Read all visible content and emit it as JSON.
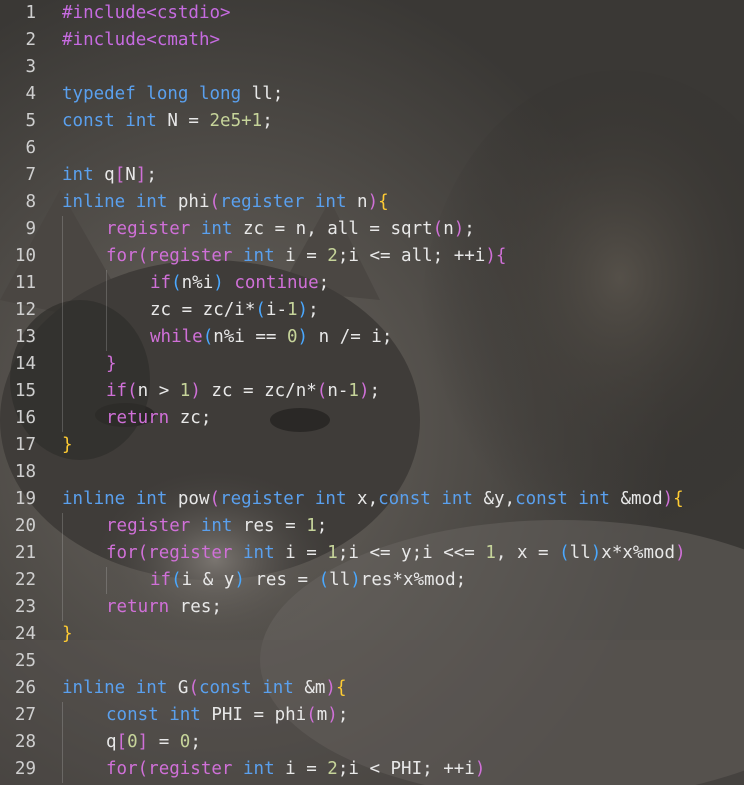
{
  "editor": {
    "lines": [
      {
        "n": "1",
        "indent": 0,
        "tokens": [
          [
            "pp",
            "#include<cstdio>"
          ]
        ]
      },
      {
        "n": "2",
        "indent": 0,
        "tokens": [
          [
            "pp",
            "#include<cmath>"
          ]
        ]
      },
      {
        "n": "3",
        "indent": 0,
        "tokens": []
      },
      {
        "n": "4",
        "indent": 0,
        "tokens": [
          [
            "kw",
            "typedef long long"
          ],
          [
            "tx",
            " ll;"
          ]
        ]
      },
      {
        "n": "5",
        "indent": 0,
        "tokens": [
          [
            "kw",
            "const int"
          ],
          [
            "tx",
            " N = "
          ],
          [
            "num",
            "2e5+1"
          ],
          [
            "tx",
            ";"
          ]
        ]
      },
      {
        "n": "6",
        "indent": 0,
        "tokens": []
      },
      {
        "n": "7",
        "indent": 0,
        "tokens": [
          [
            "kw",
            "int"
          ],
          [
            "tx",
            " q"
          ],
          [
            "br2",
            "["
          ],
          [
            "tx",
            "N"
          ],
          [
            "br2",
            "]"
          ],
          [
            "tx",
            ";"
          ]
        ]
      },
      {
        "n": "8",
        "indent": 0,
        "tokens": [
          [
            "kw",
            "inline int"
          ],
          [
            "tx",
            " phi"
          ],
          [
            "br2",
            "("
          ],
          [
            "kw",
            "register int"
          ],
          [
            "tx",
            " n"
          ],
          [
            "br2",
            ")"
          ],
          [
            "br1",
            "{"
          ]
        ]
      },
      {
        "n": "9",
        "indent": 1,
        "tokens": [
          [
            "ctl",
            "register"
          ],
          [
            "tx",
            " "
          ],
          [
            "kw",
            "int"
          ],
          [
            "tx",
            " zc = n, all = sqrt"
          ],
          [
            "br2",
            "("
          ],
          [
            "tx",
            "n"
          ],
          [
            "br2",
            ")"
          ],
          [
            "tx",
            ";"
          ]
        ]
      },
      {
        "n": "10",
        "indent": 1,
        "tokens": [
          [
            "ctl",
            "for"
          ],
          [
            "br2",
            "("
          ],
          [
            "ctl",
            "register"
          ],
          [
            "tx",
            " "
          ],
          [
            "kw",
            "int"
          ],
          [
            "tx",
            " i = "
          ],
          [
            "num",
            "2"
          ],
          [
            "tx",
            ";i <= all; ++i"
          ],
          [
            "br2",
            ")"
          ],
          [
            "br2",
            "{"
          ]
        ]
      },
      {
        "n": "11",
        "indent": 2,
        "tokens": [
          [
            "ctl",
            "if"
          ],
          [
            "br3",
            "("
          ],
          [
            "tx",
            "n%i"
          ],
          [
            "br3",
            ")"
          ],
          [
            "tx",
            " "
          ],
          [
            "ctl",
            "continue"
          ],
          [
            "tx",
            ";"
          ]
        ]
      },
      {
        "n": "12",
        "indent": 2,
        "tokens": [
          [
            "tx",
            "zc = zc/i*"
          ],
          [
            "br3",
            "("
          ],
          [
            "tx",
            "i-"
          ],
          [
            "num",
            "1"
          ],
          [
            "br3",
            ")"
          ],
          [
            "tx",
            ";"
          ]
        ]
      },
      {
        "n": "13",
        "indent": 2,
        "tokens": [
          [
            "ctl",
            "while"
          ],
          [
            "br3",
            "("
          ],
          [
            "tx",
            "n%i == "
          ],
          [
            "num",
            "0"
          ],
          [
            "br3",
            ")"
          ],
          [
            "tx",
            " n /= i;"
          ]
        ]
      },
      {
        "n": "14",
        "indent": 1,
        "tokens": [
          [
            "br2",
            "}"
          ]
        ]
      },
      {
        "n": "15",
        "indent": 1,
        "tokens": [
          [
            "ctl",
            "if"
          ],
          [
            "br2",
            "("
          ],
          [
            "tx",
            "n > "
          ],
          [
            "num",
            "1"
          ],
          [
            "br2",
            ")"
          ],
          [
            "tx",
            " zc = zc/n*"
          ],
          [
            "br2",
            "("
          ],
          [
            "tx",
            "n-"
          ],
          [
            "num",
            "1"
          ],
          [
            "br2",
            ")"
          ],
          [
            "tx",
            ";"
          ]
        ]
      },
      {
        "n": "16",
        "indent": 1,
        "tokens": [
          [
            "ctl",
            "return"
          ],
          [
            "tx",
            " zc;"
          ]
        ]
      },
      {
        "n": "17",
        "indent": 0,
        "tokens": [
          [
            "br1",
            "}"
          ]
        ]
      },
      {
        "n": "18",
        "indent": 0,
        "tokens": []
      },
      {
        "n": "19",
        "indent": 0,
        "tokens": [
          [
            "kw",
            "inline int"
          ],
          [
            "tx",
            " pow"
          ],
          [
            "br2",
            "("
          ],
          [
            "kw",
            "register int"
          ],
          [
            "tx",
            " x,"
          ],
          [
            "kw",
            "const int"
          ],
          [
            "tx",
            " &y,"
          ],
          [
            "kw",
            "const int"
          ],
          [
            "tx",
            " &mod"
          ],
          [
            "br2",
            ")"
          ],
          [
            "br1",
            "{"
          ]
        ]
      },
      {
        "n": "20",
        "indent": 1,
        "tokens": [
          [
            "ctl",
            "register"
          ],
          [
            "tx",
            " "
          ],
          [
            "kw",
            "int"
          ],
          [
            "tx",
            " res = "
          ],
          [
            "num",
            "1"
          ],
          [
            "tx",
            ";"
          ]
        ]
      },
      {
        "n": "21",
        "indent": 1,
        "tokens": [
          [
            "ctl",
            "for"
          ],
          [
            "br2",
            "("
          ],
          [
            "ctl",
            "register"
          ],
          [
            "tx",
            " "
          ],
          [
            "kw",
            "int"
          ],
          [
            "tx",
            " i = "
          ],
          [
            "num",
            "1"
          ],
          [
            "tx",
            ";i <= y;i <<= "
          ],
          [
            "num",
            "1"
          ],
          [
            "tx",
            ", x = "
          ],
          [
            "br3",
            "("
          ],
          [
            "tx",
            "ll"
          ],
          [
            "br3",
            ")"
          ],
          [
            "tx",
            "x*x%mod"
          ],
          [
            "br2",
            ")"
          ]
        ]
      },
      {
        "n": "22",
        "indent": 2,
        "tokens": [
          [
            "ctl",
            "if"
          ],
          [
            "br3",
            "("
          ],
          [
            "tx",
            "i & y"
          ],
          [
            "br3",
            ")"
          ],
          [
            "tx",
            " res = "
          ],
          [
            "br3",
            "("
          ],
          [
            "tx",
            "ll"
          ],
          [
            "br3",
            ")"
          ],
          [
            "tx",
            "res*x%mod;"
          ]
        ]
      },
      {
        "n": "23",
        "indent": 1,
        "tokens": [
          [
            "ctl",
            "return"
          ],
          [
            "tx",
            " res;"
          ]
        ]
      },
      {
        "n": "24",
        "indent": 0,
        "tokens": [
          [
            "br1",
            "}"
          ]
        ]
      },
      {
        "n": "25",
        "indent": 0,
        "tokens": []
      },
      {
        "n": "26",
        "indent": 0,
        "tokens": [
          [
            "kw",
            "inline int"
          ],
          [
            "tx",
            " G"
          ],
          [
            "br2",
            "("
          ],
          [
            "kw",
            "const int"
          ],
          [
            "tx",
            " &m"
          ],
          [
            "br2",
            ")"
          ],
          [
            "br1",
            "{"
          ]
        ]
      },
      {
        "n": "27",
        "indent": 1,
        "tokens": [
          [
            "kw",
            "const int"
          ],
          [
            "tx",
            " PHI = phi"
          ],
          [
            "br2",
            "("
          ],
          [
            "tx",
            "m"
          ],
          [
            "br2",
            ")"
          ],
          [
            "tx",
            ";"
          ]
        ]
      },
      {
        "n": "28",
        "indent": 1,
        "tokens": [
          [
            "tx",
            "q"
          ],
          [
            "br2",
            "["
          ],
          [
            "num",
            "0"
          ],
          [
            "br2",
            "]"
          ],
          [
            "tx",
            " = "
          ],
          [
            "num",
            "0"
          ],
          [
            "tx",
            ";"
          ]
        ]
      },
      {
        "n": "29",
        "indent": 1,
        "tokens": [
          [
            "ctl",
            "for"
          ],
          [
            "br2",
            "("
          ],
          [
            "ctl",
            "register"
          ],
          [
            "tx",
            " "
          ],
          [
            "kw",
            "int"
          ],
          [
            "tx",
            " i = "
          ],
          [
            "num",
            "2"
          ],
          [
            "tx",
            ";i < PHI; ++i"
          ],
          [
            "br2",
            ")"
          ]
        ]
      }
    ]
  },
  "background": {
    "description_icon": "cat-photo-wallpaper",
    "colors": [
      "#3d3b38",
      "#5a5651",
      "#2a2826",
      "#8a8580"
    ]
  }
}
